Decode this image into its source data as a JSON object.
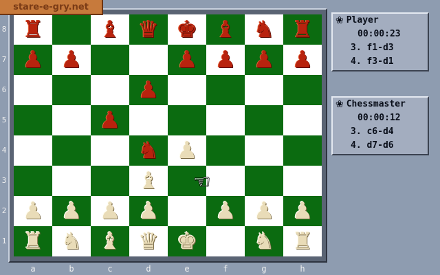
{
  "watermark": "stare-e-gry.net",
  "ranks": [
    "8",
    "7",
    "6",
    "5",
    "4",
    "3",
    "2",
    "1"
  ],
  "files": [
    "a",
    "b",
    "c",
    "d",
    "e",
    "f",
    "g",
    "h"
  ],
  "board": [
    [
      "red-rook",
      "",
      "red-bishop",
      "red-queen",
      "red-king",
      "red-bishop",
      "red-knight",
      "red-rook"
    ],
    [
      "red-pawn",
      "red-pawn",
      "",
      "",
      "red-pawn",
      "red-pawn",
      "red-pawn",
      "red-pawn"
    ],
    [
      "",
      "",
      "",
      "red-pawn",
      "",
      "",
      "",
      ""
    ],
    [
      "",
      "",
      "red-pawn",
      "",
      "",
      "",
      "",
      ""
    ],
    [
      "",
      "",
      "",
      "red-knight",
      "cream-pawn",
      "",
      "",
      ""
    ],
    [
      "",
      "",
      "",
      "cream-bishop",
      "",
      "",
      "",
      ""
    ],
    [
      "cream-pawn",
      "cream-pawn",
      "cream-pawn",
      "cream-pawn",
      "",
      "cream-pawn",
      "cream-pawn",
      "cream-pawn"
    ],
    [
      "cream-rook",
      "cream-knight",
      "cream-bishop",
      "cream-queen",
      "cream-king",
      "",
      "cream-knight",
      "cream-rook"
    ]
  ],
  "piece_glyphs": {
    "king": "♚",
    "queen": "♛",
    "rook": "♜",
    "bishop": "♝",
    "knight": "♞",
    "pawn": "♟"
  },
  "player_panel": {
    "name": "Player",
    "time": "00:00:23",
    "moves": [
      "3. f1-d3",
      "4. f3-d1"
    ]
  },
  "computer_panel": {
    "name": "Chessmaster",
    "time": "00:00:12",
    "moves": [
      "3. c6-d4",
      "4. d7-d6"
    ]
  },
  "icons": {
    "panel_icon": "paw-icon",
    "cursor": "hand-pointer-icon"
  },
  "colors": {
    "dark_square": "#0b6b10",
    "light_square": "#ffffff",
    "red_piece": "#b8230e",
    "cream_piece": "#e9dcb8",
    "background": "#8e9cb0"
  }
}
